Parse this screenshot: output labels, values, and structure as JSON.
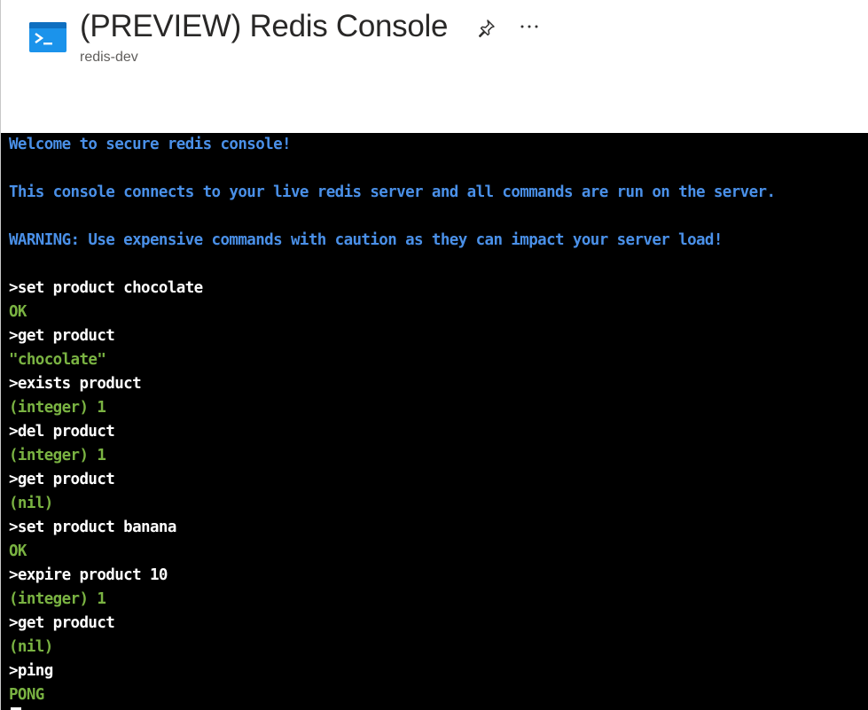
{
  "header": {
    "title": "(PREVIEW) Redis Console",
    "subtitle": "redis-dev",
    "pin_icon": "pin-icon",
    "more_icon": "more-ellipsis-icon",
    "more_label": "···"
  },
  "colors": {
    "info": "#4a90e8",
    "command": "#ffffff",
    "output": "#7ab342",
    "console_bg": "#000000",
    "icon_blue": "#1b93eb"
  },
  "console": {
    "lines": [
      {
        "type": "info",
        "text": "Welcome to secure redis console!"
      },
      {
        "type": "blank",
        "text": ""
      },
      {
        "type": "info",
        "text": "This console connects to your live redis server and all commands are run on the server."
      },
      {
        "type": "blank",
        "text": ""
      },
      {
        "type": "info",
        "text": "WARNING: Use expensive commands with caution as they can impact your server load!"
      },
      {
        "type": "blank",
        "text": ""
      },
      {
        "type": "command",
        "text": ">set product chocolate"
      },
      {
        "type": "output",
        "text": "OK"
      },
      {
        "type": "command",
        "text": ">get product"
      },
      {
        "type": "output",
        "text": "\"chocolate\""
      },
      {
        "type": "command",
        "text": ">exists product"
      },
      {
        "type": "output",
        "text": "(integer) 1"
      },
      {
        "type": "command",
        "text": ">del product"
      },
      {
        "type": "output",
        "text": "(integer) 1"
      },
      {
        "type": "command",
        "text": ">get product"
      },
      {
        "type": "output",
        "text": "(nil)"
      },
      {
        "type": "command",
        "text": ">set product banana"
      },
      {
        "type": "output",
        "text": "OK"
      },
      {
        "type": "command",
        "text": ">expire product 10"
      },
      {
        "type": "output",
        "text": "(integer) 1"
      },
      {
        "type": "command",
        "text": ">get product"
      },
      {
        "type": "output",
        "text": "(nil)"
      },
      {
        "type": "command",
        "text": ">ping"
      },
      {
        "type": "output",
        "text": "PONG"
      }
    ]
  }
}
